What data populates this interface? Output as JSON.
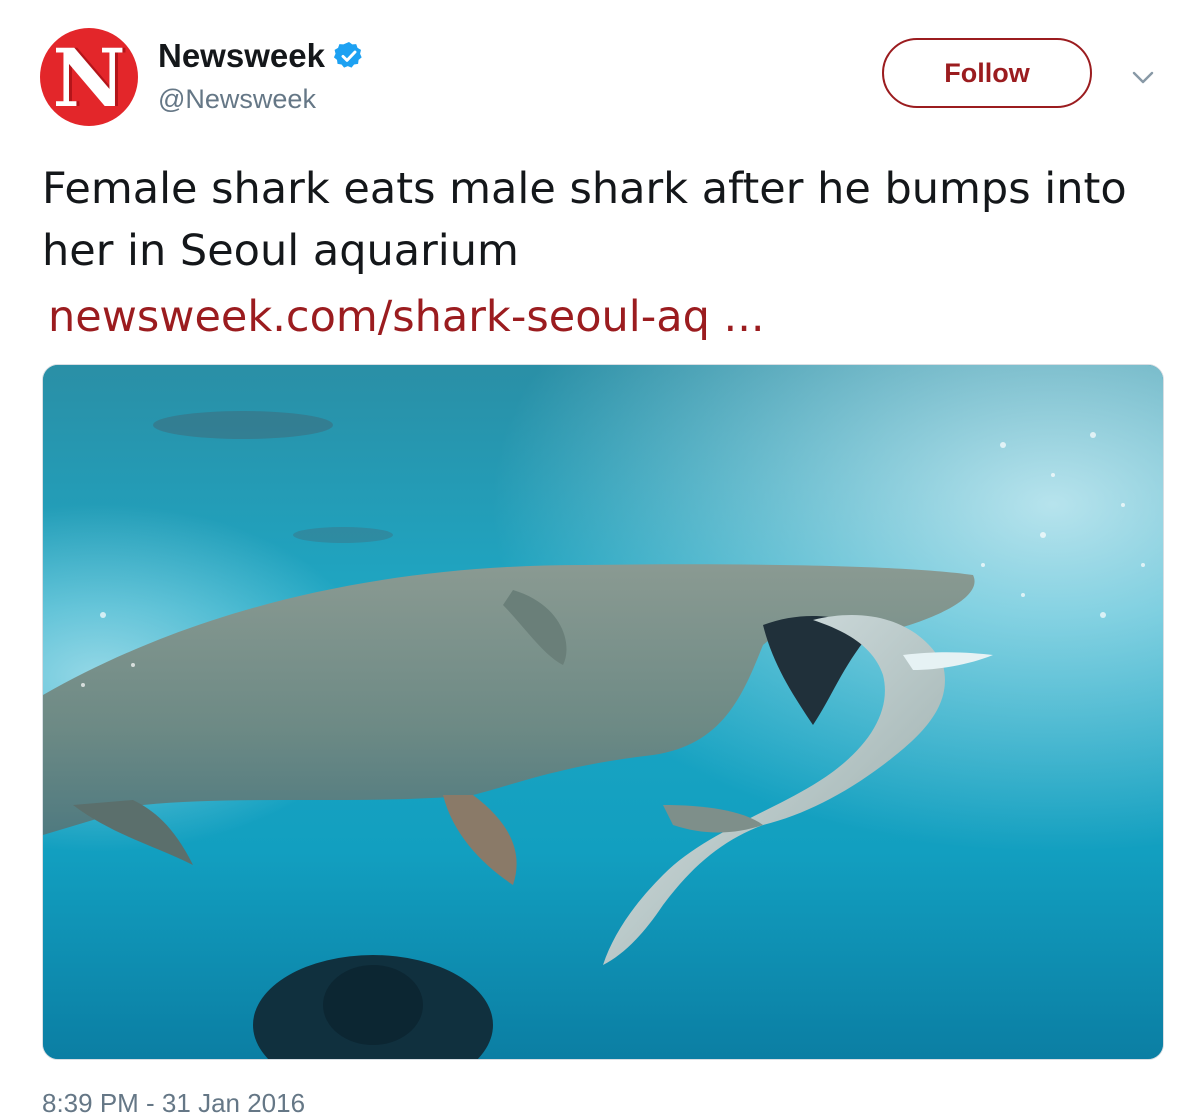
{
  "author": {
    "logo_letter": "N",
    "display_name": "Newsweek",
    "handle": "@Newsweek",
    "verified_icon": "verified-badge-icon"
  },
  "actions": {
    "follow_label": "Follow",
    "more_icon": "chevron-down-icon"
  },
  "tweet": {
    "text": "Female shark eats male shark after he bumps into her in Seoul aquarium",
    "link_text": "newsweek.com/shark-seoul-aq ...",
    "timestamp": "8:39 PM - 31 Jan 2016"
  },
  "colors": {
    "brand_red": "#e3262a",
    "link": "#9b1c1f",
    "verified": "#1da1f2",
    "muted": "#657786"
  }
}
